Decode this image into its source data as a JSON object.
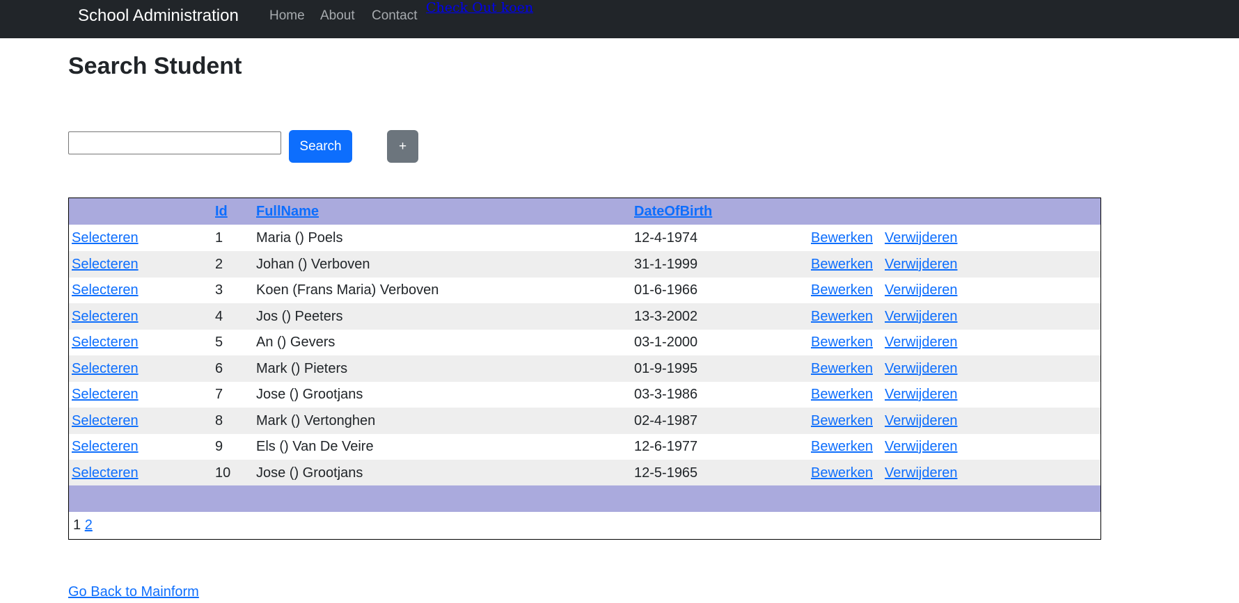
{
  "navbar": {
    "brand": "School Administration",
    "links": [
      "Home",
      "About",
      "Contact"
    ],
    "extra_link": "Check Out koen"
  },
  "page": {
    "title": "Search Student"
  },
  "search": {
    "value": "",
    "placeholder": "",
    "button_label": "Search",
    "add_label": "+"
  },
  "grid": {
    "columns": [
      "",
      "Id",
      "FullName",
      "DateOfBirth",
      ""
    ],
    "select_label": "Selecteren",
    "edit_label": "Bewerken",
    "delete_label": "Verwijderen",
    "rows": [
      {
        "id": "1",
        "name": "Maria () Poels",
        "dob": "12-4-1974"
      },
      {
        "id": "2",
        "name": "Johan () Verboven",
        "dob": "31-1-1999"
      },
      {
        "id": "3",
        "name": "Koen (Frans Maria) Verboven",
        "dob": "01-6-1966"
      },
      {
        "id": "4",
        "name": "Jos () Peeters",
        "dob": "13-3-2002"
      },
      {
        "id": "5",
        "name": "An () Gevers",
        "dob": "03-1-2000"
      },
      {
        "id": "6",
        "name": "Mark () Pieters",
        "dob": "01-9-1995"
      },
      {
        "id": "7",
        "name": "Jose () Grootjans",
        "dob": "03-3-1986"
      },
      {
        "id": "8",
        "name": "Mark () Vertonghen",
        "dob": "02-4-1987"
      },
      {
        "id": "9",
        "name": "Els () Van De Veire",
        "dob": "12-6-1977"
      },
      {
        "id": "10",
        "name": "Jose () Grootjans",
        "dob": "12-5-1965"
      }
    ],
    "pager": {
      "current": "1",
      "pages": [
        "2"
      ]
    }
  },
  "footer": {
    "back_link": "Go Back to Mainform"
  },
  "colors": {
    "navbar_bg": "#212529",
    "grid_header_bg": "#aaaadd",
    "row_alt_bg": "#eeeeee",
    "primary": "#0d6efd",
    "secondary": "#6c757d"
  }
}
